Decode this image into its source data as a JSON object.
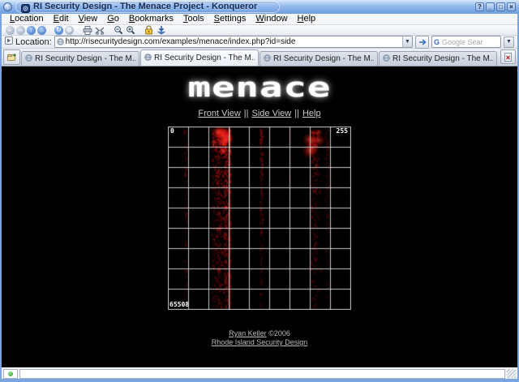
{
  "window": {
    "title": "RI Security Design - The Menace Project - Konqueror",
    "buttons": {
      "help": "?",
      "minimize": "_",
      "maximize": "□",
      "close": "×"
    }
  },
  "menubar": {
    "items": [
      "Location",
      "Edit",
      "View",
      "Go",
      "Bookmarks",
      "Tools",
      "Settings",
      "Window",
      "Help"
    ]
  },
  "toolbar": {
    "icons": [
      "back",
      "forward",
      "up",
      "home",
      "reload",
      "stop",
      "print",
      "find",
      "zoom-out",
      "zoom-in",
      "security-lock",
      "download"
    ],
    "glyphs": {
      "back": "←",
      "forward": "→",
      "up": "↑",
      "home": "⌂",
      "reload": "↻",
      "stop": "⊘"
    }
  },
  "locationbar": {
    "label": "Location:",
    "url": "http://risecuritydesign.com/examples/menace/index.php?id=side",
    "combo_arrow": "▼",
    "search": {
      "icon_letter": "G",
      "placeholder": "Google Sear",
      "arrow": "▼"
    }
  },
  "tabbar": {
    "active_index": 1,
    "tabs": [
      {
        "label": "RI Security Design - The M..."
      },
      {
        "label": "RI Security Design - The M..."
      },
      {
        "label": "RI Security Design - The M..."
      },
      {
        "label": "RI Security Design - The M..."
      }
    ]
  },
  "page": {
    "logo_text": "menace",
    "nav_separator": "||",
    "nav_links": [
      {
        "label": "Front View"
      },
      {
        "label": "Side View"
      },
      {
        "label": "Help"
      }
    ],
    "visualization": {
      "label_top_left": "0",
      "label_top_right": "255",
      "label_bottom_left": "65508",
      "cols": 9,
      "rows": 9,
      "grid_color": "rgba(210,210,210,0.95)",
      "bg_color": "#000000",
      "data_color": "#ff2a2a",
      "streaks": [
        {
          "x": 0.095,
          "w": 0.012,
          "intensity": 0.38,
          "density": 180,
          "top_glow": false,
          "line": false
        },
        {
          "x": 0.275,
          "w": 0.042,
          "intensity": 0.72,
          "density": 760,
          "top_glow": true,
          "line": false
        },
        {
          "x": 0.315,
          "w": 0.016,
          "intensity": 0.8,
          "density": 420,
          "top_glow": true,
          "line": false
        },
        {
          "x": 0.336,
          "w": 0.004,
          "intensity": 0.95,
          "density": 240,
          "top_glow": false,
          "line": true
        },
        {
          "x": 0.508,
          "w": 0.012,
          "intensity": 0.5,
          "density": 280,
          "top_glow": false,
          "line": false
        },
        {
          "x": 0.667,
          "w": 0.01,
          "intensity": 0.18,
          "density": 110,
          "top_glow": false,
          "line": false
        },
        {
          "x": 0.8,
          "w": 0.034,
          "intensity": 0.55,
          "density": 430,
          "top_glow": true,
          "line": false
        },
        {
          "x": 0.865,
          "w": 0.012,
          "intensity": 0.35,
          "density": 170,
          "top_glow": false,
          "line": false
        }
      ]
    },
    "footer": {
      "author_link": "Ryan Keller",
      "copyright": " ©2006",
      "org_link": "Rhode Island Security Design"
    }
  }
}
